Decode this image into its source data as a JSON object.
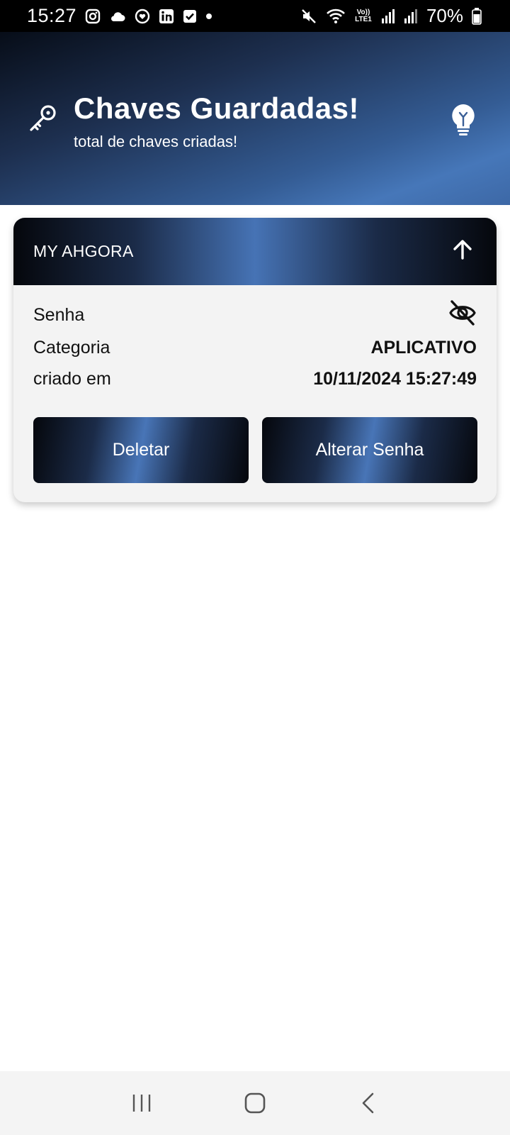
{
  "status_bar": {
    "time": "15:27",
    "battery": "70%",
    "icons_left": [
      "instagram-icon",
      "cloud-icon",
      "heart-circle-icon",
      "linkedin-icon",
      "checkbox-icon",
      "dot-icon"
    ],
    "icons_right": [
      "mute-icon",
      "wifi-icon",
      "volte-icon",
      "signal-icon",
      "signal-icon",
      "battery-icon"
    ],
    "volte_label": "Vo)) LTE1"
  },
  "header": {
    "title": "Chaves Guardadas!",
    "subtitle": "total de chaves criadas!",
    "left_icon": "key-icon",
    "right_icon": "lightbulb-icon"
  },
  "card": {
    "title": "MY AHGORA",
    "toggle_icon": "arrow-up-icon",
    "rows": [
      {
        "label": "Senha",
        "value": "",
        "icon": "eye-off-icon"
      },
      {
        "label": "Categoria",
        "value": "APLICATIVO"
      },
      {
        "label": "criado em",
        "value": "10/11/2024 15:27:49"
      }
    ],
    "buttons": {
      "delete": "Deletar",
      "change_password": "Alterar Senha"
    }
  },
  "nav_bar": {
    "items": [
      "recent-apps-icon",
      "home-icon",
      "back-icon"
    ]
  },
  "colors": {
    "status_bar_bg": "#000000",
    "header_gradient_dark": "#070d18",
    "header_gradient_light": "#4677b9",
    "card_bg": "#f3f3f3",
    "accent_blue": "#4673b5"
  }
}
